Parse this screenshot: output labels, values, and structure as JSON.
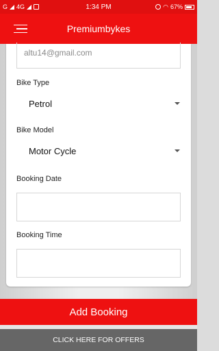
{
  "status_bar": {
    "carrier_left": "G",
    "network": "4G",
    "time": "1:34 PM",
    "battery": "67%"
  },
  "app_bar": {
    "title": "Premiumbykes"
  },
  "form": {
    "email_value": "altu14@gmail.com",
    "bike_type_label": "Bike Type",
    "bike_type_value": "Petrol",
    "bike_model_label": "Bike Model",
    "bike_model_value": "Motor Cycle",
    "booking_date_label": "Booking Date",
    "booking_date_value": "",
    "booking_time_label": "Booking Time",
    "booking_time_value": ""
  },
  "actions": {
    "add_booking": "Add Booking",
    "offers": "CLICK HERE FOR OFFERS"
  },
  "colors": {
    "primary": "#ee1111",
    "offers_bar": "#666666"
  }
}
